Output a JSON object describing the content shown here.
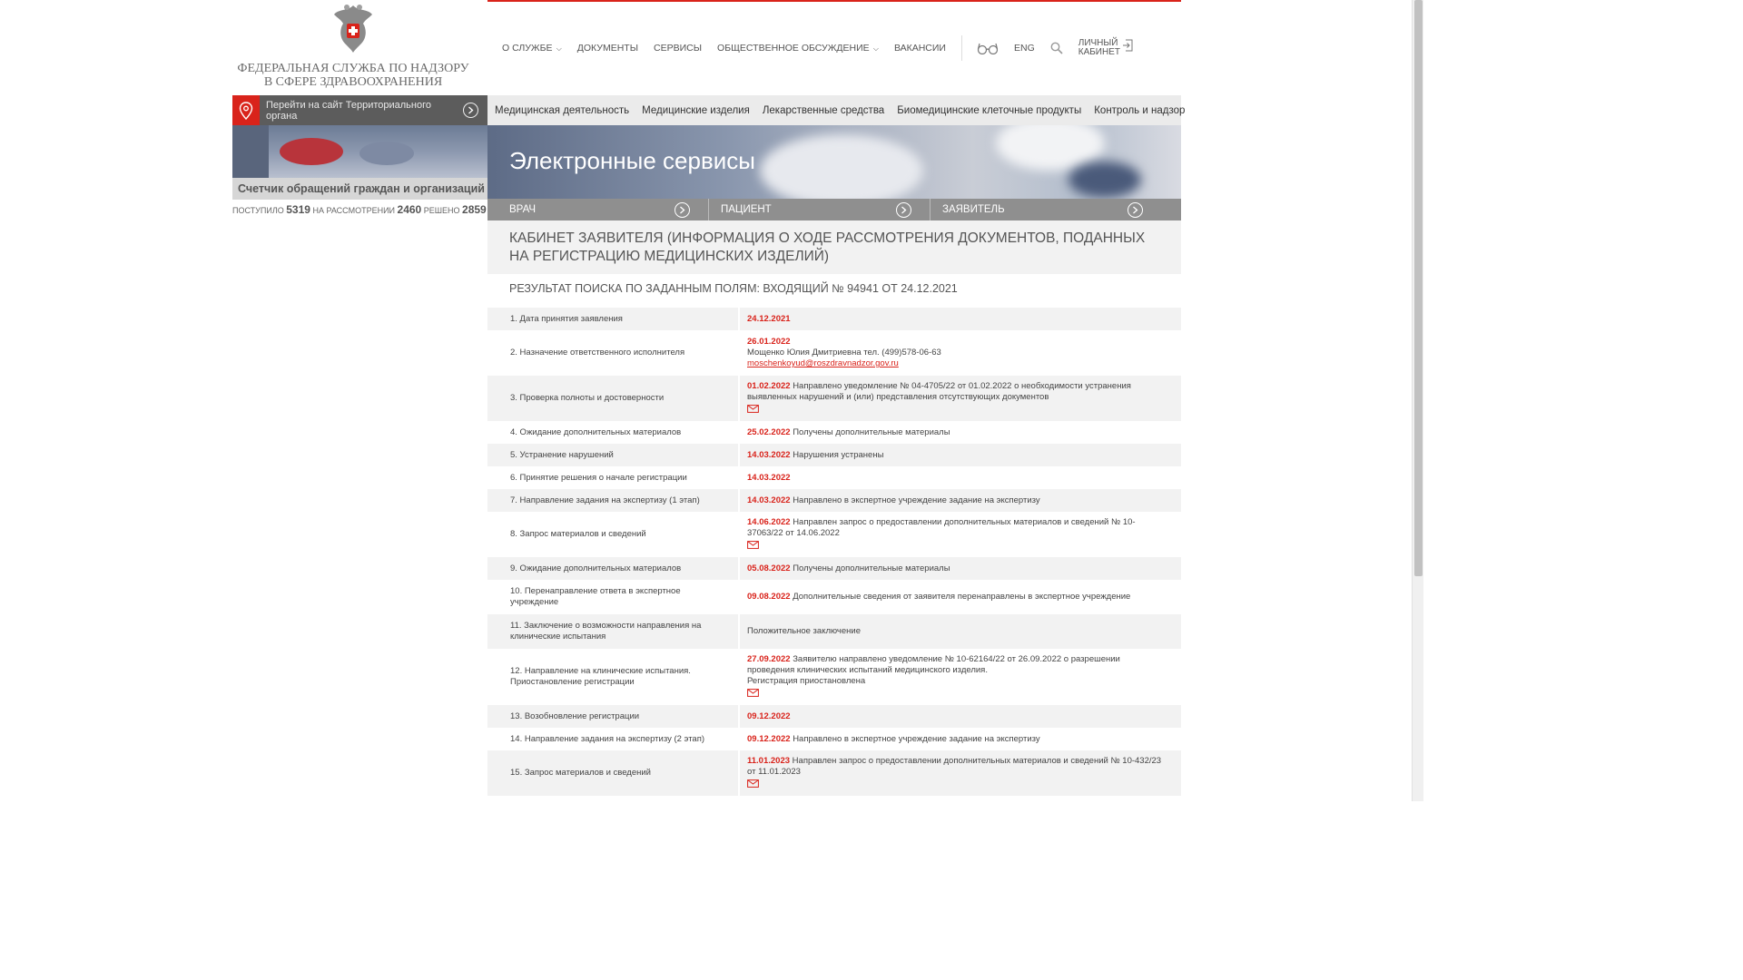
{
  "header": {
    "agency_title": "ФЕДЕРАЛЬНАЯ СЛУЖБА ПО НАДЗОРУ В СФЕРЕ ЗДРАВООХРАНЕНИЯ",
    "nav": [
      {
        "label": "О СЛУЖБЕ",
        "dropdown": true
      },
      {
        "label": "ДОКУМЕНТЫ",
        "dropdown": false
      },
      {
        "label": "СЕРВИСЫ",
        "dropdown": false
      },
      {
        "label": "ОБЩЕСТВЕННОЕ ОБСУЖДЕНИЕ",
        "dropdown": true
      },
      {
        "label": "ВАКАНСИИ",
        "dropdown": false
      }
    ],
    "lang": "ENG",
    "cabinet_line1": "ЛИЧНЫЙ",
    "cabinet_line2": "КАБИНЕТ",
    "accent_color": "#d9231b"
  },
  "region": {
    "label": "Перейти на сайт Территориального органа"
  },
  "categories": [
    "Медицинская деятельность",
    "Медицинские изделия",
    "Лекарственные средства",
    "Биомедицинские клеточные продукты",
    "Контроль и надзор"
  ],
  "counter": {
    "title": "Счетчик обращений граждан и организаций",
    "received_label": "ПОСТУПИЛО",
    "received": "5319",
    "review_label": "НА РАССМОТРЕНИИ",
    "review": "2460",
    "resolved_label": "РЕШЕНО",
    "resolved": "2859"
  },
  "banner": {
    "title": "Электронные сервисы",
    "roles": [
      "ВРАЧ",
      "ПАЦИЕНТ",
      "ЗАЯВИТЕЛЬ"
    ]
  },
  "cabinet": {
    "title": "КАБИНЕТ ЗАЯВИТЕЛЯ (ИНФОРМАЦИЯ О ХОДЕ РАССМОТРЕНИЯ ДОКУМЕНТОВ, ПОДАННЫХ НА РЕГИСТРАЦИЮ МЕДИЦИНСКИХ ИЗДЕЛИЙ)",
    "search_result": "РЕЗУЛЬТАТ ПОИСКА ПО ЗАДАННЫМ ПОЛЯМ: ВХОДЯЩИЙ № 94941 ОТ 24.12.2021"
  },
  "rows": [
    {
      "stage": "1. Дата принятия заявления",
      "date": "24.12.2021",
      "text": "",
      "lines": [],
      "email": "",
      "mail_icon": false
    },
    {
      "stage": "2. Назначение ответственного исполнителя",
      "date": "26.01.2022",
      "text": "",
      "lines": [
        "Мощенко Юлия Дмитриевна тел. (499)578-06-63"
      ],
      "email": "moschenkoyud@roszdravnadzor.gov.ru",
      "mail_icon": false
    },
    {
      "stage": "3. Проверка полноты и достоверности",
      "date": "01.02.2022",
      "text": "Направлено уведомление № 04-4705/22 от 01.02.2022 о необходимости устранения выявленных нарушений и (или) представления отсутствующих документов",
      "lines": [],
      "email": "",
      "mail_icon": true
    },
    {
      "stage": "4. Ожидание дополнительных материалов",
      "date": "25.02.2022",
      "text": "Получены дополнительные материалы",
      "lines": [],
      "email": "",
      "mail_icon": false
    },
    {
      "stage": "5. Устранение нарушений",
      "date": "14.03.2022",
      "text": "Нарушения устранены",
      "lines": [],
      "email": "",
      "mail_icon": false
    },
    {
      "stage": "6. Принятие решения о начале регистрации",
      "date": "14.03.2022",
      "text": "",
      "lines": [],
      "email": "",
      "mail_icon": false
    },
    {
      "stage": "7. Направление задания на экспертизу (1 этап)",
      "date": "14.03.2022",
      "text": "Направлено в экспертное учреждение задание на экспертизу",
      "lines": [],
      "email": "",
      "mail_icon": false
    },
    {
      "stage": "8. Запрос материалов и сведений",
      "date": "14.06.2022",
      "text": "Направлен запрос о предоставлении дополнительных материалов и сведений № 10-37063/22 от 14.06.2022",
      "lines": [],
      "email": "",
      "mail_icon": true
    },
    {
      "stage": "9. Ожидание дополнительных материалов",
      "date": "05.08.2022",
      "text": "Получены дополнительные материалы",
      "lines": [],
      "email": "",
      "mail_icon": false
    },
    {
      "stage": "10. Перенаправление ответа в экспертное учреждение",
      "date": "09.08.2022",
      "text": "Дополнительные сведения от заявителя перенаправлены в экспертное учреждение",
      "lines": [],
      "email": "",
      "mail_icon": false
    },
    {
      "stage": "11. Заключение о возможности направления на клинические испытания",
      "date": "",
      "text": "Положительное заключение",
      "lines": [],
      "email": "",
      "mail_icon": false
    },
    {
      "stage": "12. Направление на клинические испытания. Приостановление регистрации",
      "date": "27.09.2022",
      "text": "Заявителю направлено уведомление № 10-62164/22 от 26.09.2022 о разрешении проведения клинических испытаний медицинского изделия.",
      "lines": [
        "Регистрация приостановлена"
      ],
      "email": "",
      "mail_icon": true
    },
    {
      "stage": "13. Возобновление регистрации",
      "date": "09.12.2022",
      "text": "",
      "lines": [],
      "email": "",
      "mail_icon": false
    },
    {
      "stage": "14. Направление задания на экспертизу (2 этап)",
      "date": "09.12.2022",
      "text": "Направлено в экспертное учреждение задание на экспертизу",
      "lines": [],
      "email": "",
      "mail_icon": false
    },
    {
      "stage": "15. Запрос материалов и сведений",
      "date": "11.01.2023",
      "text": "Направлен запрос о предоставлении дополнительных материалов и сведений № 10-432/23 от 11.01.2023",
      "lines": [],
      "email": "",
      "mail_icon": true
    }
  ]
}
